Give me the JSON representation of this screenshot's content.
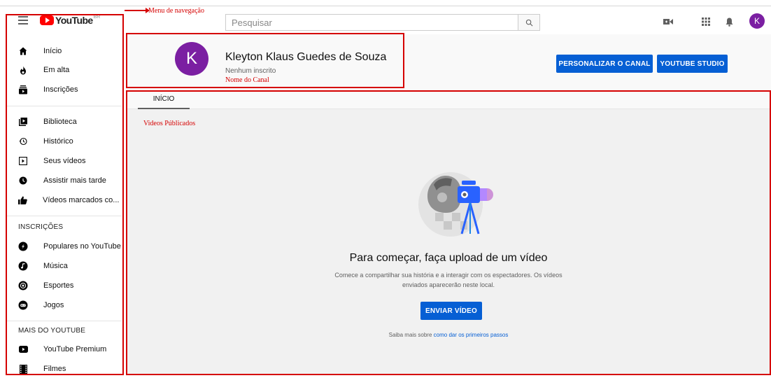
{
  "header": {
    "logo_text": "YouTube",
    "logo_country": "BR",
    "search_placeholder": "Pesquisar",
    "avatar_letter": "K"
  },
  "annotations": {
    "nav_menu": "Menu de navegação",
    "channel_name": "Nome do Canal",
    "published_videos": "Videos Públicados"
  },
  "sidebar": {
    "main": [
      {
        "label": "Início",
        "icon": "home-icon"
      },
      {
        "label": "Em alta",
        "icon": "flame-icon"
      },
      {
        "label": "Inscrições",
        "icon": "subscriptions-icon"
      }
    ],
    "library": [
      {
        "label": "Biblioteca",
        "icon": "library-icon"
      },
      {
        "label": "Histórico",
        "icon": "history-icon"
      },
      {
        "label": "Seus vídeos",
        "icon": "your-videos-icon"
      },
      {
        "label": "Assistir mais tarde",
        "icon": "watch-later-icon"
      },
      {
        "label": "Vídeos marcados co...",
        "icon": "thumbs-up-icon"
      }
    ],
    "subscriptions_heading": "INSCRIÇÕES",
    "subscriptions": [
      {
        "label": "Populares no YouTube",
        "icon": "popular-icon"
      },
      {
        "label": "Música",
        "icon": "music-icon"
      },
      {
        "label": "Esportes",
        "icon": "sports-icon"
      },
      {
        "label": "Jogos",
        "icon": "gaming-icon"
      }
    ],
    "more_heading": "MAIS DO YOUTUBE",
    "more": [
      {
        "label": "YouTube Premium",
        "icon": "youtube-premium-icon"
      },
      {
        "label": "Filmes",
        "icon": "film-icon"
      }
    ]
  },
  "channel": {
    "avatar_letter": "K",
    "name": "Kleyton Klaus Guedes de Souza",
    "subscribers": "Nenhum inscrito",
    "customize_button": "PERSONALIZAR O CANAL",
    "studio_button": "YOUTUBE STUDIO"
  },
  "tabs": {
    "active": "INÍCIO"
  },
  "empty_state": {
    "title": "Para começar, faça upload de um vídeo",
    "description": "Comece a compartilhar sua história e a interagir com os espectadores. Os vídeos enviados aparecerão neste local.",
    "upload_button": "ENVIAR VÍDEO",
    "learn_prefix": "Saiba mais sobre",
    "learn_link": "como dar os primeiros passos"
  },
  "colors": {
    "accent_blue": "#065fd4",
    "annotation_red": "#d50000",
    "avatar_purple": "#7b1fa2",
    "logo_red": "#ff0000"
  }
}
